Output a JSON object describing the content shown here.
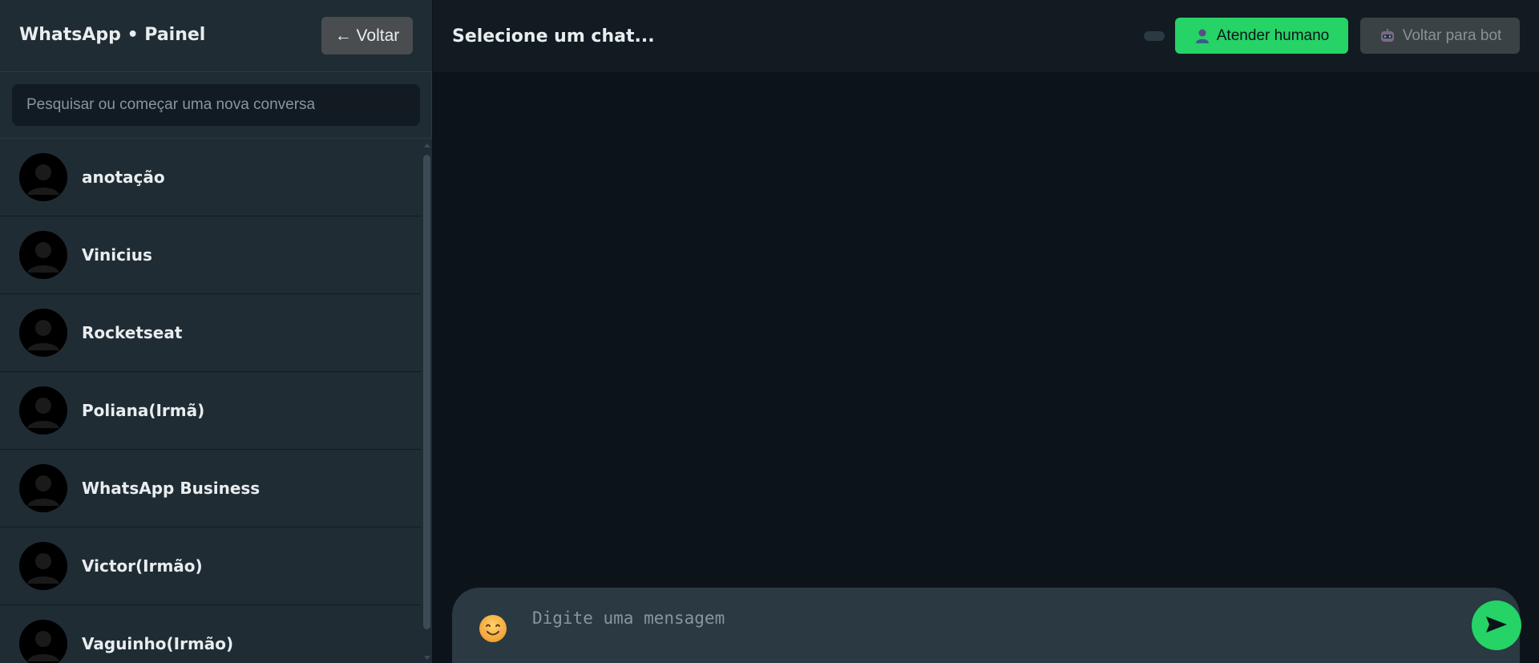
{
  "sidebar": {
    "title": "WhatsApp • Painel",
    "back_button": "← Voltar",
    "search_placeholder": "Pesquisar ou começar uma nova conversa",
    "chats": [
      {
        "name": "anotação"
      },
      {
        "name": "Vinicius"
      },
      {
        "name": "Rocketseat"
      },
      {
        "name": "Poliana(Irmã)"
      },
      {
        "name": "WhatsApp Business"
      },
      {
        "name": "Victor(Irmão)"
      },
      {
        "name": "Vaguinho(Irmão)"
      }
    ]
  },
  "main": {
    "title": "Selecione um chat...",
    "human_button": "Atender humano",
    "bot_button": "Voltar para bot",
    "composer_placeholder": "Digite uma mensagem"
  },
  "icons": {
    "human_button_icon": "person-icon",
    "bot_button_icon": "robot-icon",
    "emoji": "smiley-emoji-icon",
    "send": "send-arrow-icon",
    "avatar": "default-avatar-icon"
  },
  "colors": {
    "accent": "#25d366",
    "sidebar_bg": "#1f2c34",
    "main_bg": "#0c141a",
    "composer_bg": "#2a3942"
  }
}
